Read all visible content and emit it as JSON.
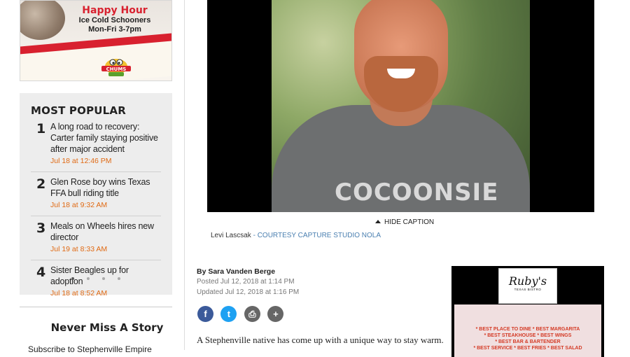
{
  "sidebar_ad": {
    "headline": "Happy Hour",
    "line2": "Ice Cold Schooners",
    "line3": "Mon-Fri 3-7pm",
    "logo_text": "CHUMS",
    "brand_color": "#d8212f"
  },
  "most_popular": {
    "heading": "MOST POPULAR",
    "items": [
      {
        "num": "1",
        "title": "A long road to recovery: Carter family staying positive after major accident",
        "date": "Jul 18 at 12:46 PM"
      },
      {
        "num": "2",
        "title": "Glen Rose boy wins Texas FFA bull riding title",
        "date": "Jul 18 at 9:32 AM"
      },
      {
        "num": "3",
        "title": "Meals on Wheels hires new director",
        "date": "Jul 19 at 8:33 AM"
      },
      {
        "num": "4",
        "title": "Sister Beagles up for adoption",
        "date": "Jul 18 at 8:52 AM"
      }
    ],
    "accent_color": "#e06a14"
  },
  "newsletter": {
    "heading": "Never Miss A Story",
    "subtext": "Subscribe to Stephenville Empire"
  },
  "photo": {
    "shirt_text": "COCOONSIE",
    "hide_caption_label": "HIDE CAPTION",
    "caption_name": "Levi Lascsak",
    "caption_credit": "- COURTESY CAPTURE STUDIO NOLA"
  },
  "article": {
    "byline": "By Sara Vanden Berge",
    "posted": "Posted Jul 12, 2018 at 1:14 PM",
    "updated": "Updated Jul 12, 2018 at 1:16 PM",
    "lede": "A Stephenville native has come up with a unique way to stay warm."
  },
  "share_buttons": [
    {
      "icon": "facebook-icon",
      "glyph": "f"
    },
    {
      "icon": "twitter-icon",
      "glyph": "t"
    },
    {
      "icon": "print-icon",
      "glyph": "⎙"
    },
    {
      "icon": "plus-icon",
      "glyph": "+"
    }
  ],
  "right_ad": {
    "logo_name": "Ruby's",
    "logo_sub": "TEXAS BISTRO",
    "line1": "* BEST PLACE TO DINE   * BEST MARGARITA",
    "line2": "* BEST STEAKHOUSE   * BEST WINGS",
    "line3": "* BEST BAR & BARTENDER",
    "line4": "* BEST SERVICE  * BEST FRIES  * BEST SALAD"
  }
}
